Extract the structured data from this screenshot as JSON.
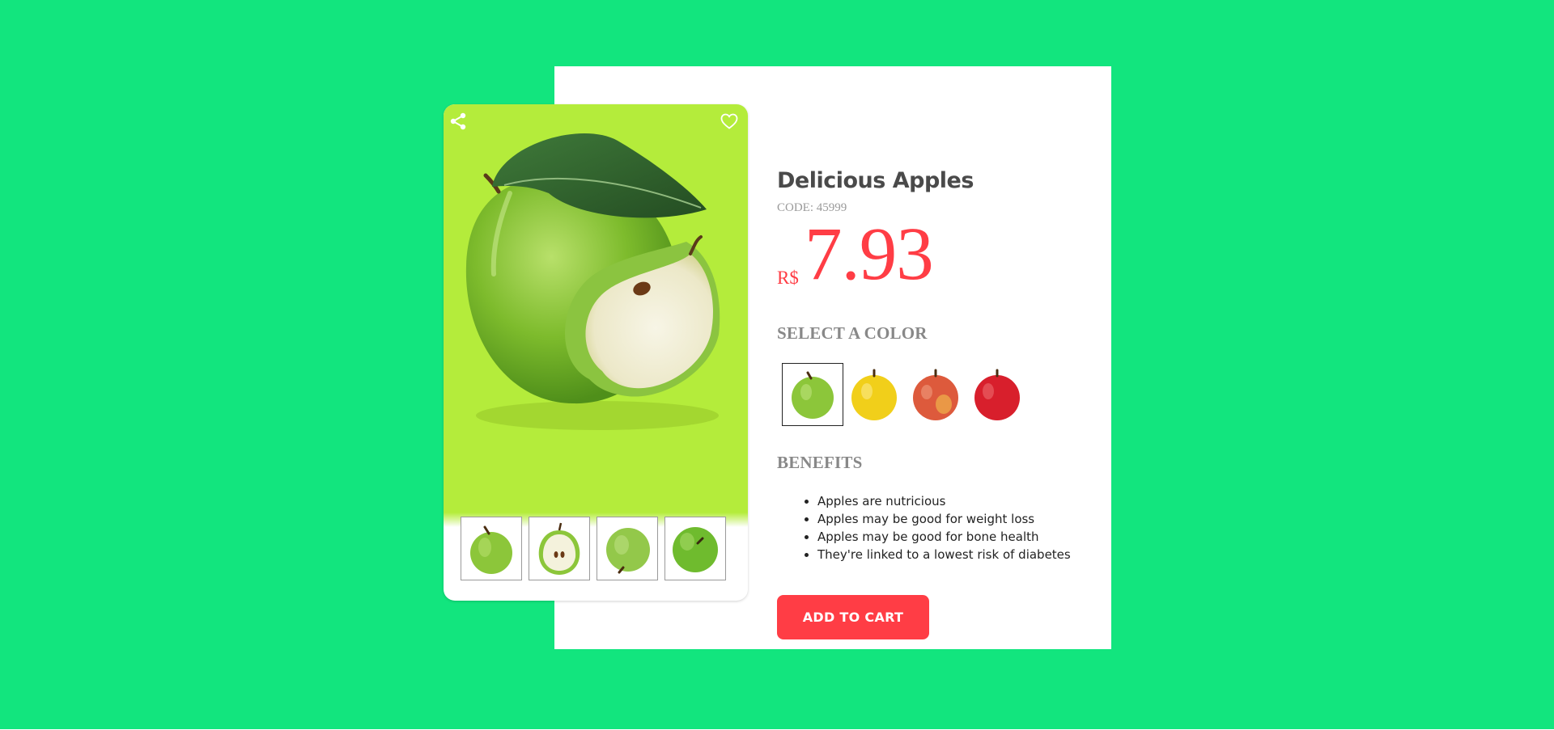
{
  "product": {
    "title": "Delicious Apples",
    "code": "CODE: 45999",
    "currency": "R$",
    "price": "7.93"
  },
  "icons": {
    "share": "share-icon",
    "favorite": "heart-icon"
  },
  "thumbnails": [
    "green-apple-front",
    "green-apple-half-cut",
    "green-apple-side",
    "green-apple-top"
  ],
  "color_section": {
    "title": "SELECT A COLOR",
    "options": [
      {
        "name": "green",
        "color": "#8cc63a",
        "selected": true
      },
      {
        "name": "yellow",
        "color": "#f1cf1a",
        "selected": false
      },
      {
        "name": "red-yellow",
        "color": "#dd5a3c",
        "selected": false
      },
      {
        "name": "red",
        "color": "#d81f2c",
        "selected": false
      }
    ]
  },
  "benefits": {
    "title": "BENEFITS",
    "items": [
      "Apples are nutricious",
      "Apples may be good for weight loss",
      "Apples may be good for bone health",
      "They're linked to a lowest risk of diabetes"
    ]
  },
  "actions": {
    "add_to_cart": "ADD TO CART"
  },
  "colors": {
    "background": "#12e57e",
    "accent": "#ff3d45",
    "hero": "#b4ec3b"
  }
}
